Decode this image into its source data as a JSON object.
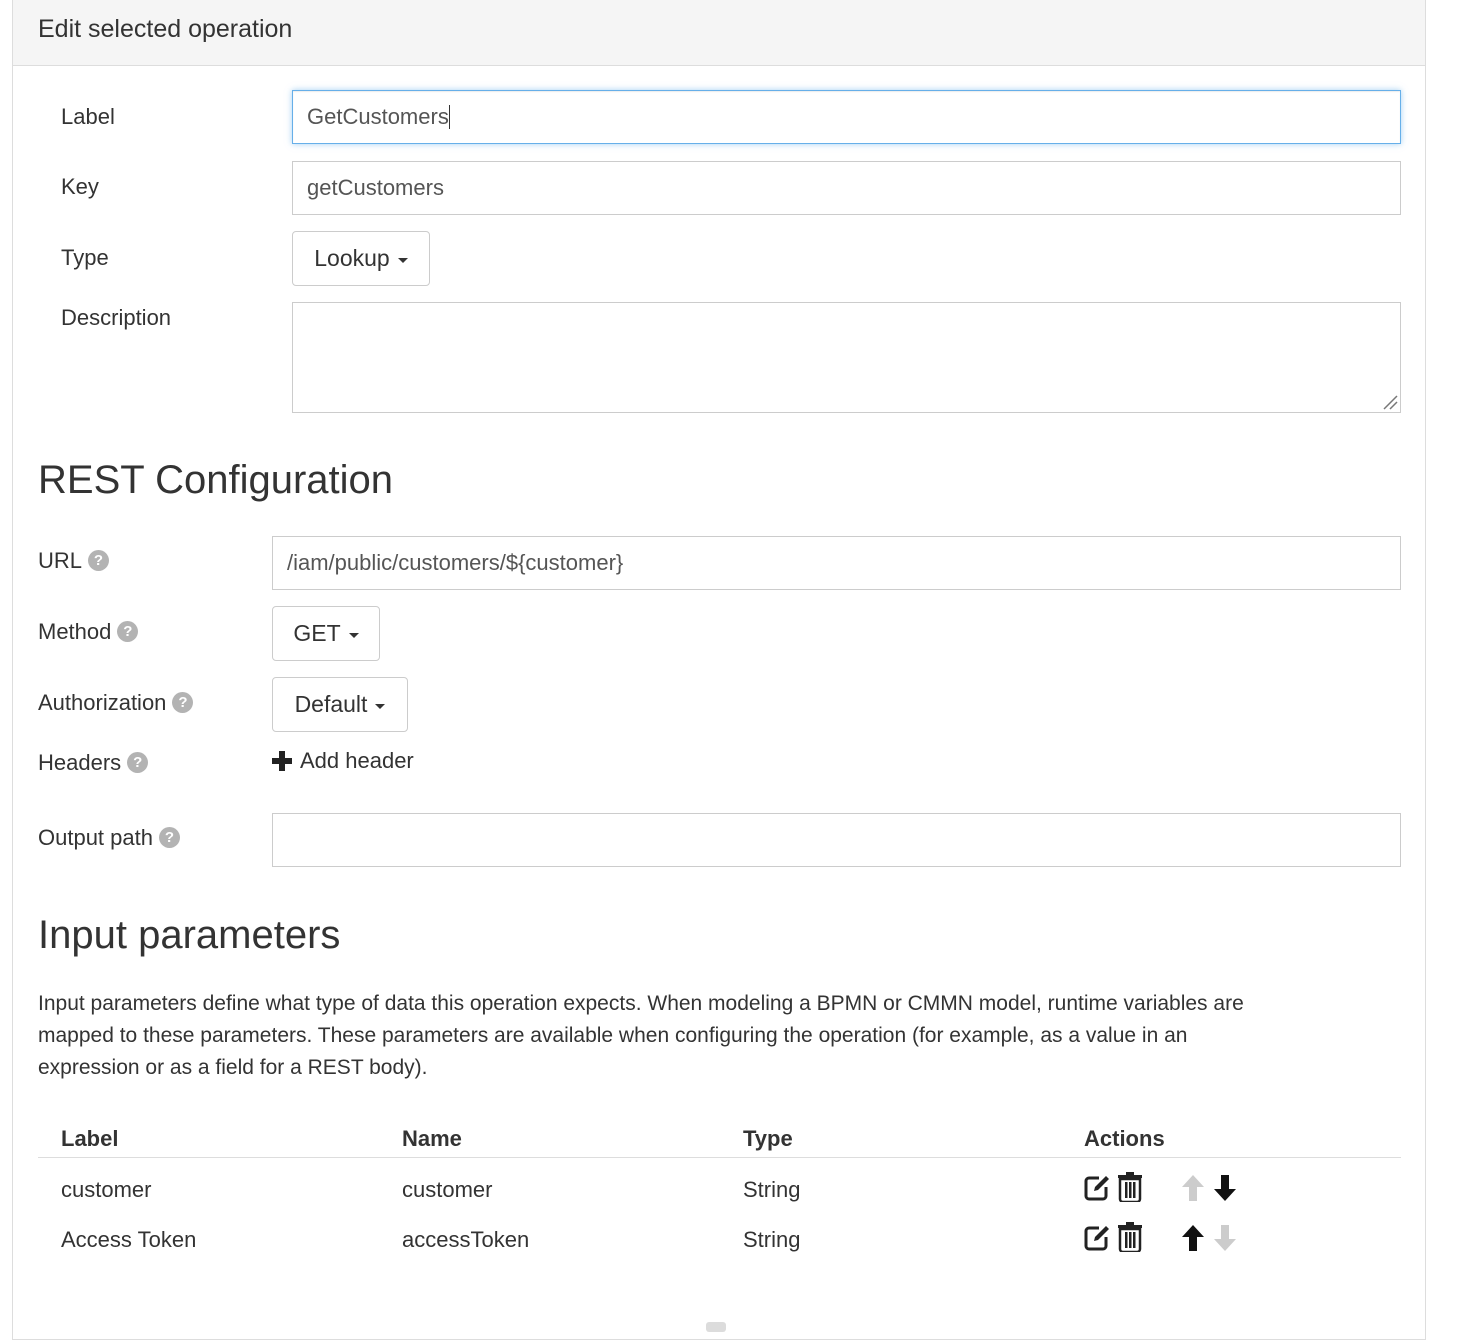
{
  "panel": {
    "title": "Edit selected operation"
  },
  "general": {
    "label_label": "Label",
    "label_value": "GetCustomers",
    "key_label": "Key",
    "key_value": "getCustomers",
    "type_label": "Type",
    "type_value": "Lookup",
    "description_label": "Description",
    "description_value": ""
  },
  "rest": {
    "heading": "REST Configuration",
    "url_label": "URL",
    "url_value": "/iam/public/customers/${customer}",
    "method_label": "Method",
    "method_value": "GET",
    "authorization_label": "Authorization",
    "authorization_value": "Default",
    "headers_label": "Headers",
    "add_header_label": "Add header",
    "output_path_label": "Output path",
    "output_path_value": "",
    "help_glyph": "?"
  },
  "input_params": {
    "heading": "Input parameters",
    "description": "Input parameters define what type of data this operation expects. When modeling a BPMN or CMMN model, runtime variables are mapped to these parameters. These parameters are available when configuring the operation (for example, as a value in an expression or as a field for a REST body).",
    "columns": [
      "Label",
      "Name",
      "Type",
      "Actions"
    ],
    "rows": [
      {
        "label": "customer",
        "name": "customer",
        "type": "String",
        "up_enabled": false,
        "down_enabled": true
      },
      {
        "label": "Access Token",
        "name": "accessToken",
        "type": "String",
        "up_enabled": true,
        "down_enabled": false
      }
    ]
  },
  "icons": {
    "help": "question-circle-icon",
    "add": "plus-icon",
    "edit": "edit-icon",
    "delete": "trash-icon",
    "up": "arrow-up-icon",
    "down": "arrow-down-icon"
  },
  "colors": {
    "focus_border": "#66afe9",
    "heading_bg": "#f5f5f5",
    "disabled_arrow": "#cccccc"
  }
}
